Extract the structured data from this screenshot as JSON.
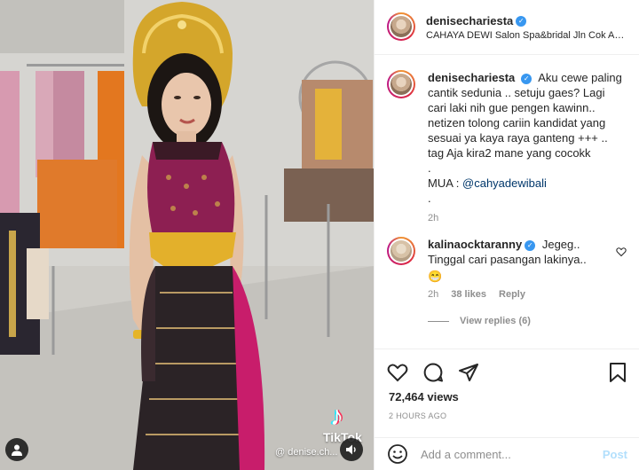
{
  "post": {
    "username": "denisechariesta",
    "location": "CAHAYA DEWI Salon Spa&bridal Jln Cok Agu...",
    "caption_text": "Aku cewe paling cantik sedunia .. setuju gaes? Lagi cari laki nih gue pengen kawinn.. netizen tolong cariin kandidat yang sesuai ya kaya raya ganteng +++ .. tag Aja kira2 mane yang cocokk",
    "caption_dot": ".",
    "mua_label": "MUA : ",
    "mua_mention": "@cahyadewibali",
    "caption_time": "2h",
    "views": "72,464 views",
    "posted_ago": "2 HOURS AGO"
  },
  "comment": {
    "username": "kalinaocktaranny",
    "text": "Jegeg.. Tinggal cari pasangan lakinya..",
    "emoji": "😁",
    "time": "2h",
    "likes": "38 likes",
    "reply_label": "Reply",
    "view_replies": "View replies (6)"
  },
  "media": {
    "tiktok_word": "TikTok",
    "tiktok_user": "@ denise.ch..."
  },
  "composer": {
    "placeholder": "Add a comment...",
    "post_label": "Post"
  },
  "icons": {
    "verified": "verified-badge",
    "like": "heart-icon",
    "comment": "comment-icon",
    "share": "paper-plane-icon",
    "save": "bookmark-icon",
    "emoji": "smiley-icon"
  }
}
